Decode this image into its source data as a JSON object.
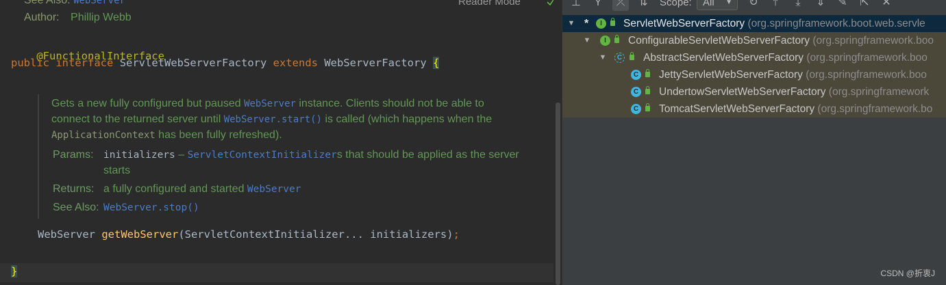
{
  "editor": {
    "top_doc": {
      "see_also_label": "See Also:",
      "see_also_link": "WebServer",
      "author_label": "Author:",
      "author_value": "Phillip Webb"
    },
    "reader_mode": "Reader Mode",
    "annotation": "@FunctionalInterface",
    "decl": {
      "kw_public": "public",
      "kw_interface": "interface",
      "name": "ServletWebServerFactory",
      "kw_extends": "extends",
      "parent": "WebServerFactory",
      "open_brace": "{"
    },
    "javadoc": {
      "l1_a": "Gets a new fully configured but paused ",
      "l1_code": "WebServer",
      "l1_b": " instance. Clients should not be able to",
      "l2_a": "connect to the returned server until ",
      "l2_code": "WebServer.start()",
      "l2_b": " is called (which happens when the",
      "l3_code": "ApplicationContext",
      "l3_b": " has been fully refreshed).",
      "params_label": "Params:",
      "params_code1": "initializers",
      "params_dash": " – ",
      "params_code2": "ServletContextInitializer",
      "params_rest": "s that should be applied as the server",
      "params_rest2": "starts",
      "returns_label": "Returns:",
      "returns_text": "a fully configured and started ",
      "returns_code": "WebServer",
      "see_label": "See Also:",
      "see_code": "WebServer.stop()"
    },
    "method": {
      "ret": "WebServer ",
      "name": "getWebServer",
      "params": "(ServletContextInitializer... initializers)",
      "semi": ";"
    },
    "close_brace": "}"
  },
  "hierarchy": {
    "scope_label": "Scope:",
    "scope_value": "All",
    "tree": [
      {
        "name": "ServletWebServerFactory",
        "pkg": " (org.springframework.boot.web.servle",
        "kind": "I"
      },
      {
        "name": "ConfigurableServletWebServerFactory",
        "pkg": " (org.springframework.boo",
        "kind": "I"
      },
      {
        "name": "AbstractServletWebServerFactory",
        "pkg": " (org.springframework.boo",
        "kind": "C"
      },
      {
        "name": "JettyServletWebServerFactory",
        "pkg": " (org.springframework.boo",
        "kind": "C"
      },
      {
        "name": "UndertowServletWebServerFactory",
        "pkg": " (org.springframework",
        "kind": "C"
      },
      {
        "name": "TomcatServletWebServerFactory",
        "pkg": " (org.springframework.bo",
        "kind": "C"
      }
    ]
  },
  "watermark": "CSDN @折衷J",
  "colors": {
    "editor_bg": "#2b2b2b",
    "panel_bg": "#3c3f41",
    "selection": "#0d293e",
    "javadoc_green": "#629755",
    "keyword": "#cc7832"
  }
}
